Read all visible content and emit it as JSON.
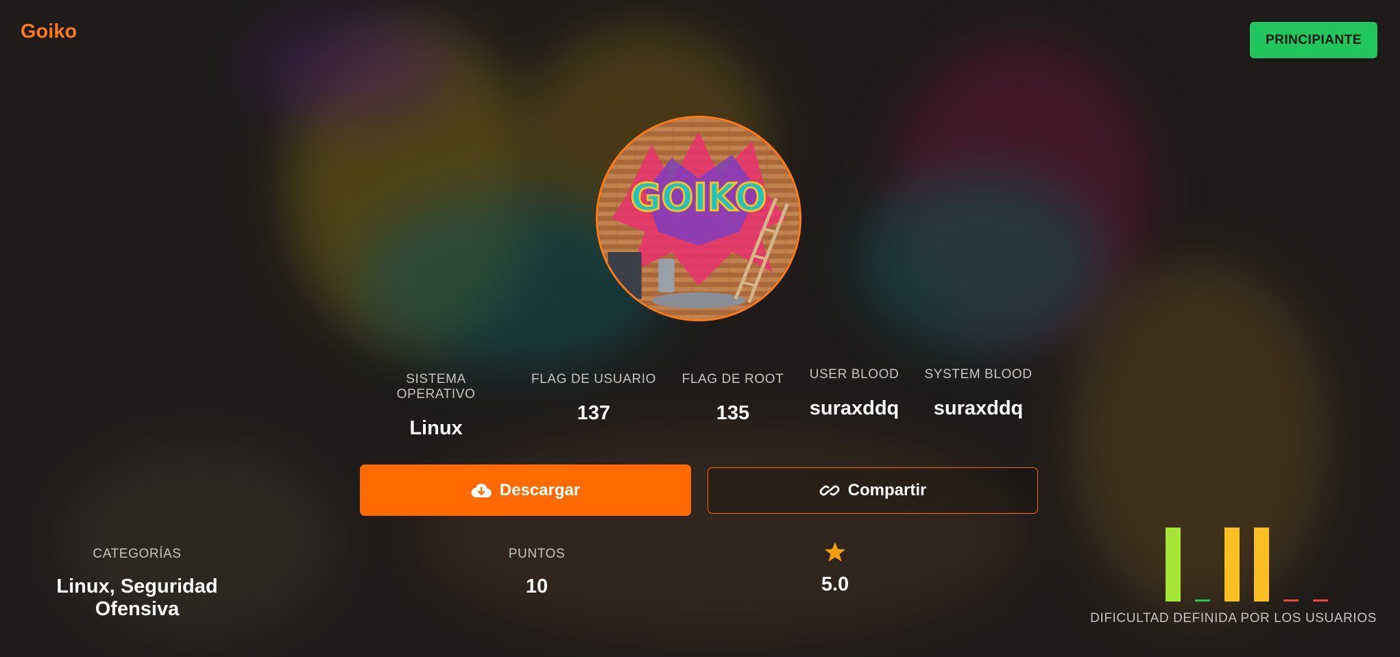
{
  "machine": {
    "name": "Goiko",
    "level": "PRINCIPIANTE",
    "avatar_alt": "GOIKO"
  },
  "stats": [
    {
      "label": "SISTEMA OPERATIVO",
      "value": "Linux"
    },
    {
      "label": "FLAG DE USUARIO",
      "value": "137"
    },
    {
      "label": "FLAG DE ROOT",
      "value": "135"
    },
    {
      "label": "USER BLOOD",
      "value": "suraxddq"
    },
    {
      "label": "SYSTEM BLOOD",
      "value": "suraxddq"
    }
  ],
  "actions": {
    "download_label": "Descargar",
    "share_label": "Compartir"
  },
  "details": {
    "categories_label": "CATEGORÍAS",
    "categories_value": "Linux, Seguridad Ofensiva",
    "points_label": "PUNTOS",
    "points_value": "10",
    "rating_value": "5.0"
  },
  "difficulty": {
    "caption": "DIFICULTAD DEFINIDA POR LOS USUARIOS",
    "bars": [
      {
        "level": 1.0,
        "color": "#a3e635"
      },
      {
        "level": 0.03,
        "color": "#22c55e"
      },
      {
        "level": 1.0,
        "color": "#fbbf24"
      },
      {
        "level": 1.0,
        "color": "#fbbf24"
      },
      {
        "level": 0.03,
        "color": "#ef4444"
      },
      {
        "level": 0.03,
        "color": "#ef4444"
      }
    ]
  },
  "colors": {
    "accent": "#ff6b00",
    "level_badge": "#22c55e",
    "star": "#f59e0b"
  },
  "icons": {
    "download": "cloud-download-icon",
    "share": "link-icon",
    "rating": "star-icon"
  }
}
